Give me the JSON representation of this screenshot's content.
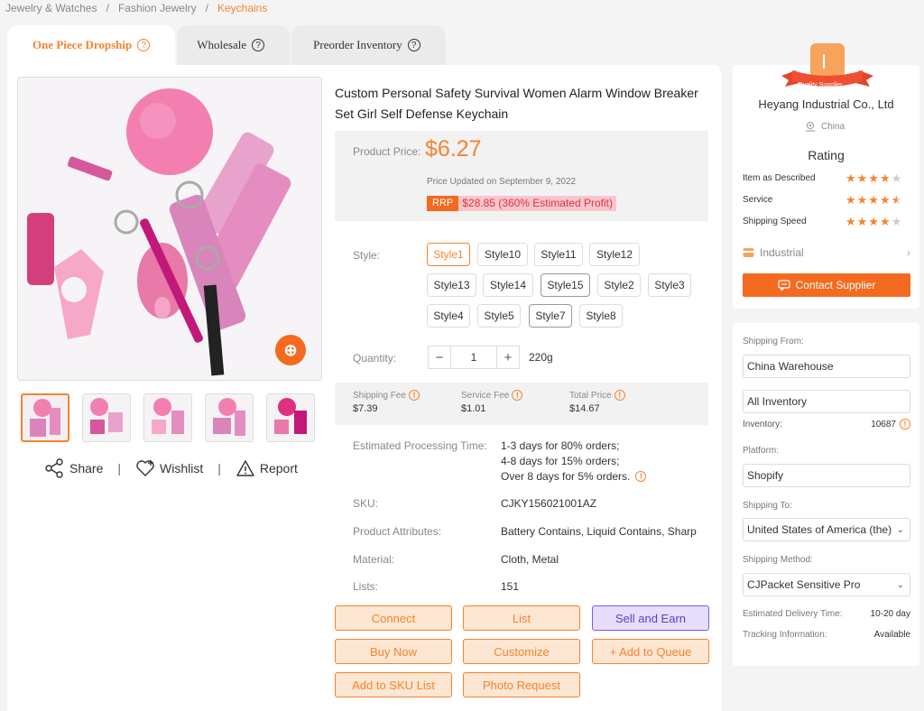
{
  "breadcrumb": {
    "items": [
      "Jewelry & Watches",
      "Fashion Jewelry"
    ],
    "separator": "/",
    "current": "Keychains"
  },
  "tabs": [
    {
      "label": "One Piece Dropship",
      "active": true
    },
    {
      "label": "Wholesale",
      "active": false
    },
    {
      "label": "Preorder Inventory",
      "active": false
    }
  ],
  "help_glyph": "?",
  "gallery": {
    "photo_badge_icon": "image-search-icon",
    "thumb_count": 5
  },
  "share_actions": {
    "share": "Share",
    "wishlist": "Wishlist",
    "report": "Report",
    "separator": "|"
  },
  "product": {
    "title": "Custom Personal Safety Survival Women Alarm Window Breaker Set Girl Self Defense Keychain",
    "price_label": "Product Price:",
    "price": "$6.27",
    "price_updated": "Price Updated on September 9, 2022",
    "rrp_tag": "RRP",
    "rrp_value": "$28.85 (360% Estimated Profit)"
  },
  "style": {
    "label": "Style:",
    "options": [
      "Style1",
      "Style10",
      "Style11",
      "Style12",
      "Style13",
      "Style14",
      "Style15",
      "Style2",
      "Style3",
      "Style4",
      "Style5",
      "Style7",
      "Style8"
    ],
    "selected": "Style1",
    "highlighted": [
      "Style15",
      "Style7"
    ]
  },
  "quantity": {
    "label": "Quantity:",
    "minus": "−",
    "value": "1",
    "plus": "+",
    "weight": "220g"
  },
  "fees": {
    "shipping_label": "Shipping Fee",
    "shipping_value": "$7.39",
    "service_label": "Service Fee",
    "service_value": "$1.01",
    "total_label": "Total Price",
    "total_value": "$14.67",
    "info_glyph": "!"
  },
  "details": {
    "processing_label": "Estimated Processing Time:",
    "processing_lines": [
      "1-3 days for 80% orders;",
      "4-8 days for 15% orders;",
      "Over 8 days for 5% orders."
    ],
    "sku_label": "SKU:",
    "sku": "CJKY156021001AZ",
    "attributes_label": "Product Attributes:",
    "attributes": "Battery Contains, Liquid Contains, Sharp",
    "material_label": "Material:",
    "material": "Cloth, Metal",
    "lists_label": "Lists:",
    "lists": "151"
  },
  "buttons": {
    "connect": "Connect",
    "list": "List",
    "sell_and_earn": "Sell and Earn",
    "buy_now": "Buy Now",
    "customize": "Customize",
    "add_to_queue": "+ Add to Queue",
    "add_to_sku_list": "Add to SKU List",
    "photo_request": "Photo Request"
  },
  "supplier": {
    "logo_letter": "I",
    "ribbon": "Quality Supplier",
    "name": "Heyang Industrial Co., Ltd",
    "country": "China",
    "rating_title": "Rating",
    "ratings": [
      {
        "label": "Item as Described",
        "score": 4
      },
      {
        "label": "Service",
        "score": 4.5
      },
      {
        "label": "Shipping Speed",
        "score": 4
      }
    ],
    "industry": "Industrial",
    "contact_button": "Contact Supplier"
  },
  "shipping": {
    "from_label": "Shipping From:",
    "from_value": "China Warehouse",
    "inventory_filter": "All Inventory",
    "inventory_label": "Inventory:",
    "inventory_value": "10687",
    "platform_label": "Platform:",
    "platform_value": "Shopify",
    "to_label": "Shipping To:",
    "to_value": "United States of America (the)",
    "method_label": "Shipping Method:",
    "method_value": "CJPacket Sensitive Pro",
    "delivery_label": "Estimated Delivery Time:",
    "delivery_value": "10-20 day",
    "tracking_label": "Tracking Information:",
    "tracking_value": "Available"
  },
  "colors": {
    "accent": "#f7832e",
    "accent_bg": "#fde6d2",
    "purple": "#5b3dc9",
    "rrp_pink": "#f9c6cd"
  }
}
